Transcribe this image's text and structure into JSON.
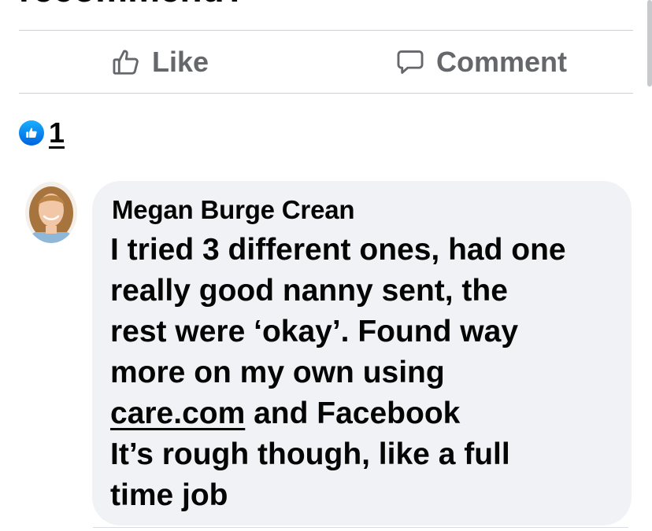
{
  "post": {
    "truncated_text": "recommend?"
  },
  "actions": {
    "like_label": "Like",
    "comment_label": "Comment"
  },
  "reactions": {
    "count": "1"
  },
  "comment": {
    "author": "Megan Burge Crean",
    "lines": [
      "I tried 3 different ones, had one",
      "really good nanny sent, the",
      "rest were ‘okay’. Found way",
      "more on my own using"
    ],
    "link_text": "care.com",
    "after_link": " and Facebook",
    "closing_lines": [
      "It’s rough though, like a full",
      "time job"
    ]
  },
  "colors": {
    "action_gray": "#65676b",
    "bubble_bg": "#f0f2f5",
    "like_blue": "#1877f2"
  }
}
